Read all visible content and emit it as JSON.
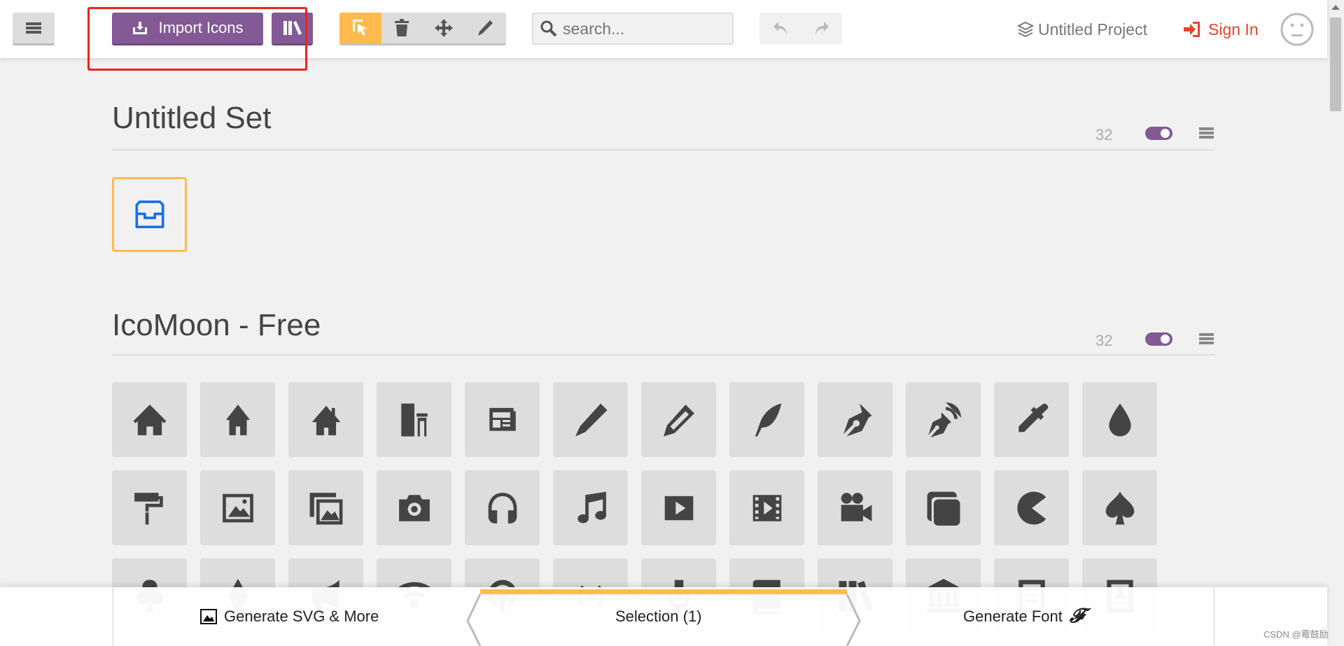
{
  "header": {
    "import_label": "Import Icons",
    "search_placeholder": "search...",
    "project_label": "Untitled Project",
    "signin_label": "Sign In"
  },
  "colors": {
    "accent": "#835a95",
    "selection": "#ffbb4d",
    "signin": "#e8412d",
    "selected_icon": "#1a6ce8"
  },
  "sets": [
    {
      "title": "Untitled Set",
      "count": "32",
      "enabled": true,
      "icons": [
        "drawer"
      ]
    },
    {
      "title": "IcoMoon - Free",
      "count": "32",
      "enabled": true,
      "icons": [
        "home",
        "home2",
        "home3",
        "office",
        "newspaper",
        "pencil",
        "pencil2",
        "quill",
        "pen",
        "blog",
        "eyedropper",
        "droplet",
        "paint-format",
        "image",
        "images",
        "camera",
        "headphones",
        "music",
        "play",
        "film",
        "video-camera",
        "dice",
        "pacman",
        "spades",
        "clubs",
        "diamonds",
        "bullhorn",
        "connection",
        "podcast",
        "feed",
        "mic",
        "book",
        "books",
        "library",
        "file-text",
        "profile"
      ]
    }
  ],
  "bottom": {
    "generate_svg_label": "Generate SVG & More",
    "selection_label": "Selection (1)",
    "generate_font_label": "Generate Font"
  },
  "watermark": "CSDN @霉鼓励"
}
